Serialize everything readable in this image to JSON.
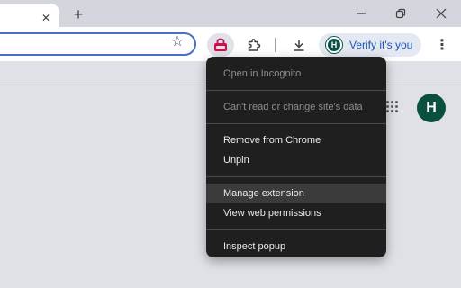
{
  "tabstrip": {
    "tab_close_glyph": "✕",
    "new_tab_glyph": "+",
    "minimize_glyph": "—",
    "restore_glyph": "❐",
    "close_glyph": "✕"
  },
  "toolbar": {
    "bookmark_glyph": "☆",
    "verify_label": "Verify it's you",
    "avatar_letter": "H",
    "menu_glyph": "⋮"
  },
  "page": {
    "avatar_letter": "H"
  },
  "context_menu": {
    "items": [
      {
        "label": "Open in Incognito",
        "disabled": true
      },
      {
        "label": "Can't read or change site's data",
        "disabled": true
      },
      {
        "label": "Remove from Chrome",
        "disabled": false
      },
      {
        "label": "Unpin",
        "disabled": false
      },
      {
        "label": "Manage extension",
        "disabled": false,
        "highlighted": true
      },
      {
        "label": "View web permissions",
        "disabled": false
      },
      {
        "label": "Inspect popup",
        "disabled": false
      }
    ]
  },
  "colors": {
    "menu_bg": "#1f1f1f",
    "menu_hover": "#3b3b3b",
    "accent_blue": "#1a56b5",
    "avatar_green": "#0b4f3f",
    "extension_icon": "#c8134f"
  }
}
